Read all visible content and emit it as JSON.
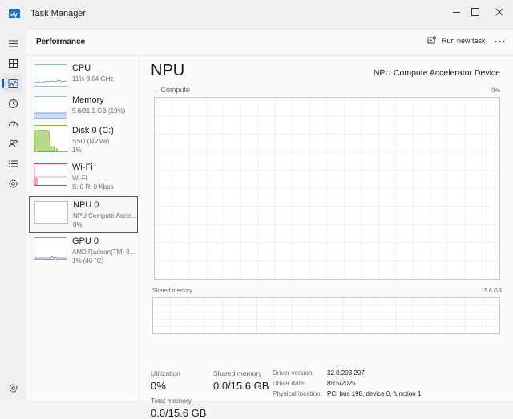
{
  "window": {
    "title": "Task Manager",
    "icon": "task-manager-icon"
  },
  "header": {
    "page_title": "Performance",
    "run_new_task": "Run new task",
    "more_options": "···"
  },
  "nav": [
    "hamburger-icon",
    "processes-icon",
    "performance-icon",
    "app-history-icon",
    "startup-apps-icon",
    "users-icon",
    "details-icon",
    "services-icon",
    "settings-icon"
  ],
  "devices": [
    {
      "name": "CPU",
      "line1": "11%  3.04 GHz",
      "line2": ""
    },
    {
      "name": "Memory",
      "line1": "5.8/31.1 GB (19%)",
      "line2": ""
    },
    {
      "name": "Disk 0 (C:)",
      "line1": "SSD (NVMe)",
      "line2": "1%"
    },
    {
      "name": "Wi-Fi",
      "line1": "Wi-Fi",
      "line2": "S: 0 R: 0 Kbps"
    },
    {
      "name": "NPU 0",
      "line1": "NPU Compute Accel...",
      "line2": "0%"
    },
    {
      "name": "GPU 0",
      "line1": "AMD Radeon(TM) 8...",
      "line2": "1%  (46 °C)"
    }
  ],
  "npu": {
    "title": "NPU",
    "device_name": "NPU Compute Accelerator Device",
    "graph_label": "Compute",
    "graph_max": "0%",
    "shared_memory_label": "Shared memory",
    "shared_memory_max": "15.6 GB",
    "stats": {
      "utilization_label": "Utilization",
      "utilization_value": "0%",
      "shared_memory_label": "Shared memory",
      "shared_memory_value": "0.0/15.6 GB",
      "total_memory_label": "Total memory",
      "total_memory_value": "0.0/15.6 GB"
    },
    "properties": [
      {
        "key": "Driver version:",
        "value": "32.0.203.297"
      },
      {
        "key": "Driver date:",
        "value": "8/15/2025"
      },
      {
        "key": "Physical location:",
        "value": "PCI bus 198, device 0, function 1"
      }
    ]
  },
  "colors": {
    "accent": "#1a5fb4",
    "cpu_line": "#4a8fd6",
    "disk_fill": "#b9d98a",
    "wifi_line": "#c8407a",
    "gpu_line": "#8a54c4"
  }
}
